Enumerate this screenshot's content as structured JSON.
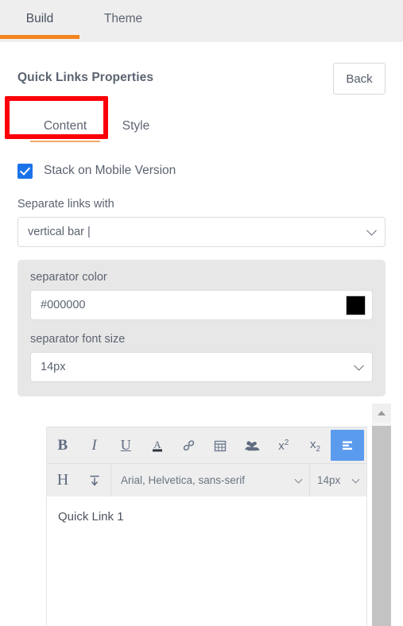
{
  "topbar": {
    "tabs": [
      {
        "label": "Build",
        "active": true
      },
      {
        "label": "Theme",
        "active": false
      }
    ],
    "accent_color": "#f3851f"
  },
  "panel": {
    "title": "Quick Links Properties",
    "back_label": "Back",
    "subtabs": [
      {
        "label": "Content",
        "active": true
      },
      {
        "label": "Style",
        "active": false
      }
    ],
    "annotation_color": "#fb0007"
  },
  "form": {
    "stack_checkbox": {
      "label": "Stack on Mobile Version",
      "checked": true,
      "color": "#1a73e8"
    },
    "separate_links": {
      "label": "Separate links with",
      "value": "vertical bar |"
    },
    "separator_color": {
      "label": "separator color",
      "value": "#000000",
      "swatch": "#000000"
    },
    "separator_font_size": {
      "label": "separator font size",
      "value": "14px"
    }
  },
  "editor": {
    "toolbar_row1": [
      {
        "name": "bold-icon",
        "glyph": "B"
      },
      {
        "name": "italic-icon",
        "glyph": "I"
      },
      {
        "name": "underline-icon",
        "glyph": "U"
      },
      {
        "name": "text-color-icon",
        "glyph": "A"
      },
      {
        "name": "link-icon",
        "glyph": "link"
      },
      {
        "name": "calendar-icon",
        "glyph": "calendar"
      },
      {
        "name": "users-icon",
        "glyph": "users"
      },
      {
        "name": "superscript-icon",
        "glyph": "x2"
      },
      {
        "name": "subscript-icon",
        "glyph": "x2"
      },
      {
        "name": "align-icon",
        "glyph": "align",
        "active": true
      }
    ],
    "heading_glyph": "H",
    "indent_glyph": "indent",
    "font_family": "Arial, Helvetica, sans-serif",
    "font_size": "14px",
    "body_text": "Quick Link 1",
    "active_button_color": "#5b9bed"
  }
}
